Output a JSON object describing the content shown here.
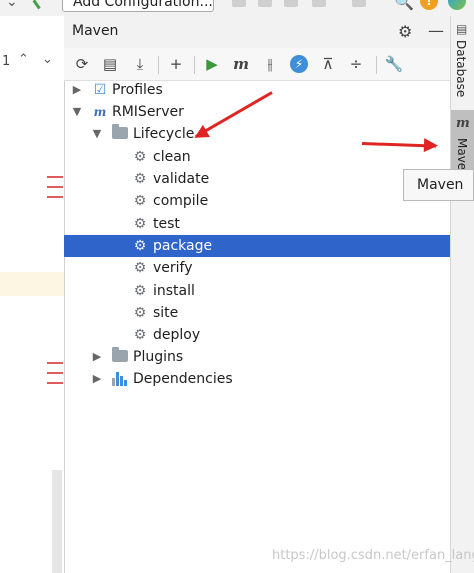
{
  "toolbar_top": {
    "run_config_label": "Add Configuration..."
  },
  "panel": {
    "title": "Maven"
  },
  "editor": {
    "line_number": "1"
  },
  "tree": [
    {
      "label": "Profiles",
      "icon": "profiles-icon",
      "arrow": "▶"
    },
    {
      "label": "RMIServer",
      "icon": "maven-project-icon",
      "arrow": "▼"
    },
    {
      "label": "Lifecycle",
      "icon": "folder-gear-icon",
      "arrow": "▼"
    },
    {
      "label": "clean",
      "icon": "gear-icon"
    },
    {
      "label": "validate",
      "icon": "gear-icon"
    },
    {
      "label": "compile",
      "icon": "gear-icon"
    },
    {
      "label": "test",
      "icon": "gear-icon"
    },
    {
      "label": "package",
      "icon": "gear-icon",
      "selected": true
    },
    {
      "label": "verify",
      "icon": "gear-icon"
    },
    {
      "label": "install",
      "icon": "gear-icon"
    },
    {
      "label": "site",
      "icon": "gear-icon"
    },
    {
      "label": "deploy",
      "icon": "gear-icon"
    },
    {
      "label": "Plugins",
      "icon": "folder-gear-icon",
      "arrow": "▶"
    },
    {
      "label": "Dependencies",
      "icon": "dependencies-icon",
      "arrow": "▶"
    }
  ],
  "side_tabs": {
    "database": "Database",
    "maven": "Mave"
  },
  "tooltip": {
    "text": "Maven"
  },
  "watermark": "https://blog.csdn.net/erfan_lang",
  "colors": {
    "selection": "#2f65ca",
    "annotation_arrow": "#e02424",
    "run_green": "#3a9a3a"
  }
}
